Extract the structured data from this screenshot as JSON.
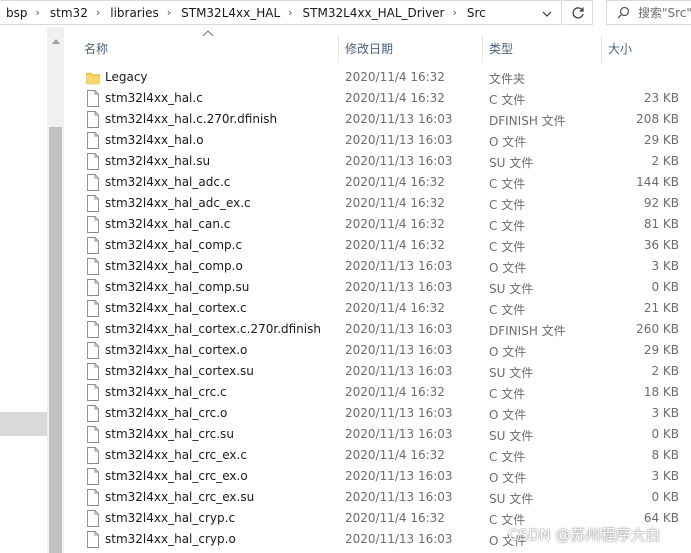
{
  "breadcrumb": [
    "bsp",
    "stm32",
    "libraries",
    "STM32L4xx_HAL",
    "STM32L4xx_HAL_Driver",
    "Src"
  ],
  "search": {
    "placeholder": "搜索\"Src\""
  },
  "columns": {
    "name": "名称",
    "date": "修改日期",
    "type": "类型",
    "size": "大小"
  },
  "files": [
    {
      "name": "Legacy",
      "date": "2020/11/4 16:32",
      "type": "文件夹",
      "size": "",
      "icon": "folder-icon"
    },
    {
      "name": "stm32l4xx_hal.c",
      "date": "2020/11/4 16:32",
      "type": "C 文件",
      "size": "23 KB",
      "icon": "file-icon"
    },
    {
      "name": "stm32l4xx_hal.c.270r.dfinish",
      "date": "2020/11/13 16:03",
      "type": "DFINISH 文件",
      "size": "208 KB",
      "icon": "file-icon"
    },
    {
      "name": "stm32l4xx_hal.o",
      "date": "2020/11/13 16:03",
      "type": "O 文件",
      "size": "29 KB",
      "icon": "file-icon"
    },
    {
      "name": "stm32l4xx_hal.su",
      "date": "2020/11/13 16:03",
      "type": "SU 文件",
      "size": "2 KB",
      "icon": "file-icon"
    },
    {
      "name": "stm32l4xx_hal_adc.c",
      "date": "2020/11/4 16:32",
      "type": "C 文件",
      "size": "144 KB",
      "icon": "file-icon"
    },
    {
      "name": "stm32l4xx_hal_adc_ex.c",
      "date": "2020/11/4 16:32",
      "type": "C 文件",
      "size": "92 KB",
      "icon": "file-icon"
    },
    {
      "name": "stm32l4xx_hal_can.c",
      "date": "2020/11/4 16:32",
      "type": "C 文件",
      "size": "81 KB",
      "icon": "file-icon"
    },
    {
      "name": "stm32l4xx_hal_comp.c",
      "date": "2020/11/4 16:32",
      "type": "C 文件",
      "size": "36 KB",
      "icon": "file-icon"
    },
    {
      "name": "stm32l4xx_hal_comp.o",
      "date": "2020/11/13 16:03",
      "type": "O 文件",
      "size": "3 KB",
      "icon": "file-icon"
    },
    {
      "name": "stm32l4xx_hal_comp.su",
      "date": "2020/11/13 16:03",
      "type": "SU 文件",
      "size": "0 KB",
      "icon": "file-icon"
    },
    {
      "name": "stm32l4xx_hal_cortex.c",
      "date": "2020/11/4 16:32",
      "type": "C 文件",
      "size": "21 KB",
      "icon": "file-icon"
    },
    {
      "name": "stm32l4xx_hal_cortex.c.270r.dfinish",
      "date": "2020/11/13 16:03",
      "type": "DFINISH 文件",
      "size": "260 KB",
      "icon": "file-icon"
    },
    {
      "name": "stm32l4xx_hal_cortex.o",
      "date": "2020/11/13 16:03",
      "type": "O 文件",
      "size": "29 KB",
      "icon": "file-icon"
    },
    {
      "name": "stm32l4xx_hal_cortex.su",
      "date": "2020/11/13 16:03",
      "type": "SU 文件",
      "size": "2 KB",
      "icon": "file-icon"
    },
    {
      "name": "stm32l4xx_hal_crc.c",
      "date": "2020/11/4 16:32",
      "type": "C 文件",
      "size": "18 KB",
      "icon": "file-icon"
    },
    {
      "name": "stm32l4xx_hal_crc.o",
      "date": "2020/11/13 16:03",
      "type": "O 文件",
      "size": "3 KB",
      "icon": "file-icon"
    },
    {
      "name": "stm32l4xx_hal_crc.su",
      "date": "2020/11/13 16:03",
      "type": "SU 文件",
      "size": "0 KB",
      "icon": "file-icon"
    },
    {
      "name": "stm32l4xx_hal_crc_ex.c",
      "date": "2020/11/4 16:32",
      "type": "C 文件",
      "size": "8 KB",
      "icon": "file-icon"
    },
    {
      "name": "stm32l4xx_hal_crc_ex.o",
      "date": "2020/11/13 16:03",
      "type": "O 文件",
      "size": "3 KB",
      "icon": "file-icon"
    },
    {
      "name": "stm32l4xx_hal_crc_ex.su",
      "date": "2020/11/13 16:03",
      "type": "SU 文件",
      "size": "0 KB",
      "icon": "file-icon"
    },
    {
      "name": "stm32l4xx_hal_cryp.c",
      "date": "2020/11/4 16:32",
      "type": "C 文件",
      "size": "64 KB",
      "icon": "file-icon"
    },
    {
      "name": "stm32l4xx_hal_cryp.o",
      "date": "2020/11/13 16:03",
      "type": "O 文件",
      "size": "",
      "icon": "file-icon"
    }
  ],
  "watermark": "CSDN @苏州程序大白",
  "colors": {
    "folder": "#f4c84a",
    "header_text": "#4c607a",
    "muted_text": "#6d6d6d"
  }
}
